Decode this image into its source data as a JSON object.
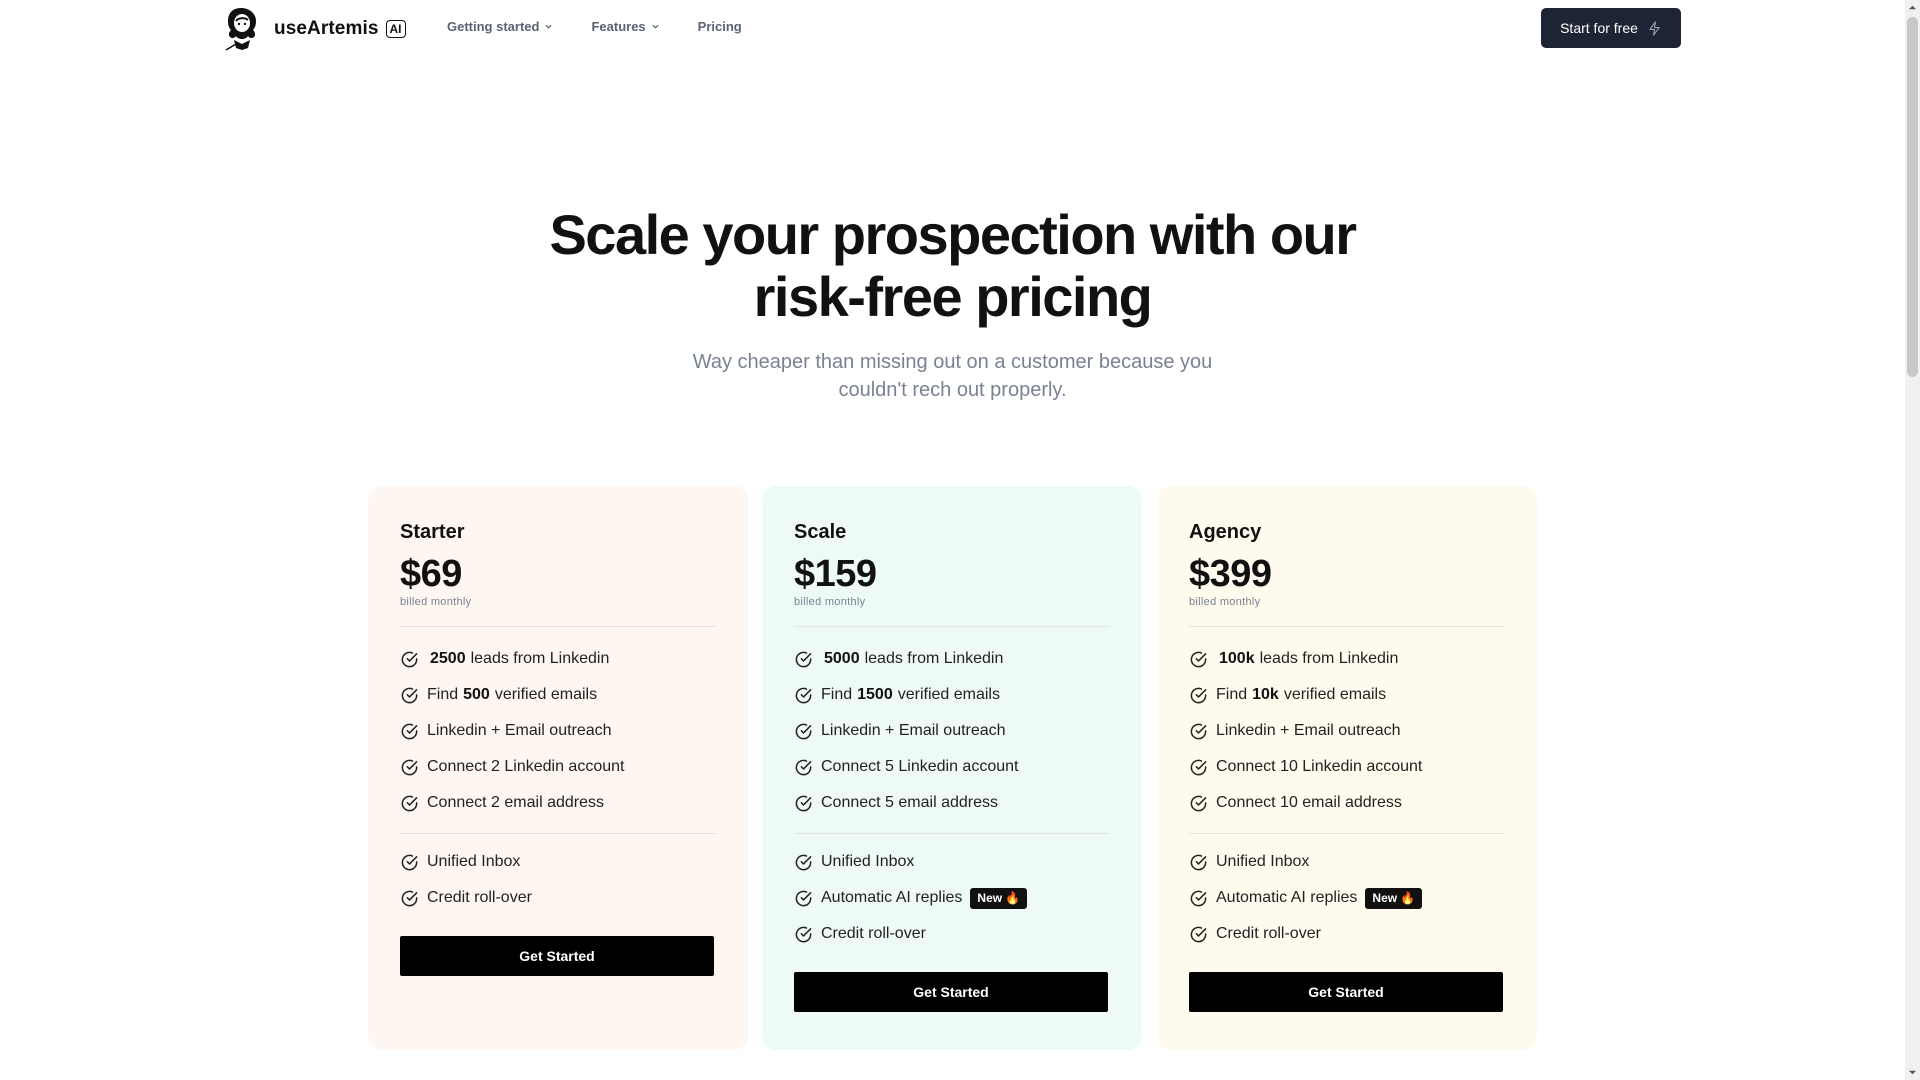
{
  "header": {
    "brand": "useArtemis",
    "ai_badge": "AI",
    "nav": [
      {
        "label": "Getting started",
        "has_dropdown": true
      },
      {
        "label": "Features",
        "has_dropdown": true
      },
      {
        "label": "Pricing",
        "has_dropdown": false
      }
    ],
    "cta_label": "Start for free",
    "cta_icon": "lightning-icon"
  },
  "hero": {
    "title_line1": "Scale your prospection with our",
    "title_line2": "risk-free pricing",
    "subtitle_line1": "Way cheaper than missing out on a customer because you",
    "subtitle_line2": "couldn't rech out properly."
  },
  "plans": [
    {
      "name": "Starter",
      "price": "$69",
      "billing": "billed monthly",
      "leads": "2500",
      "leads_suffix": "leads from Linkedin",
      "emails_prefix": "Find",
      "emails": "500",
      "emails_suffix": "verified emails",
      "outreach": "Linkedin + Email outreach",
      "linkedin_accounts": "Connect 2 Linkedin account",
      "email_addresses": "Connect 2 email address",
      "inbox": "Unified Inbox",
      "credit": "Credit roll-over",
      "button": "Get Started"
    },
    {
      "name": "Scale",
      "price": "$159",
      "billing": "billed monthly",
      "leads": "5000",
      "leads_suffix": "leads from Linkedin",
      "emails_prefix": "Find",
      "emails": "1500",
      "emails_suffix": "verified emails",
      "outreach": "Linkedin + Email outreach",
      "linkedin_accounts": "Connect 5 Linkedin account",
      "email_addresses": "Connect 5 email address",
      "inbox": "Unified Inbox",
      "ai_replies": "Automatic AI replies",
      "new_badge": "New 🔥",
      "credit": "Credit roll-over",
      "button": "Get Started"
    },
    {
      "name": "Agency",
      "price": "$399",
      "billing": "billed monthly",
      "leads": "100k",
      "leads_suffix": "leads from Linkedin",
      "emails_prefix": "Find",
      "emails": "10k",
      "emails_suffix": "verified emails",
      "outreach": "Linkedin + Email outreach",
      "linkedin_accounts": "Connect 10 Linkedin account",
      "email_addresses": "Connect 10 email address",
      "inbox": "Unified Inbox",
      "ai_replies": "Automatic AI replies",
      "new_badge": "New 🔥",
      "credit": "Credit roll-over",
      "button": "Get Started"
    }
  ],
  "colors": {
    "starter_bg": "#fdf6f1",
    "scale_bg": "#eefaf5",
    "agency_bg": "#fefbee",
    "cta_bg": "#1d2433",
    "button_bg": "#000000"
  }
}
